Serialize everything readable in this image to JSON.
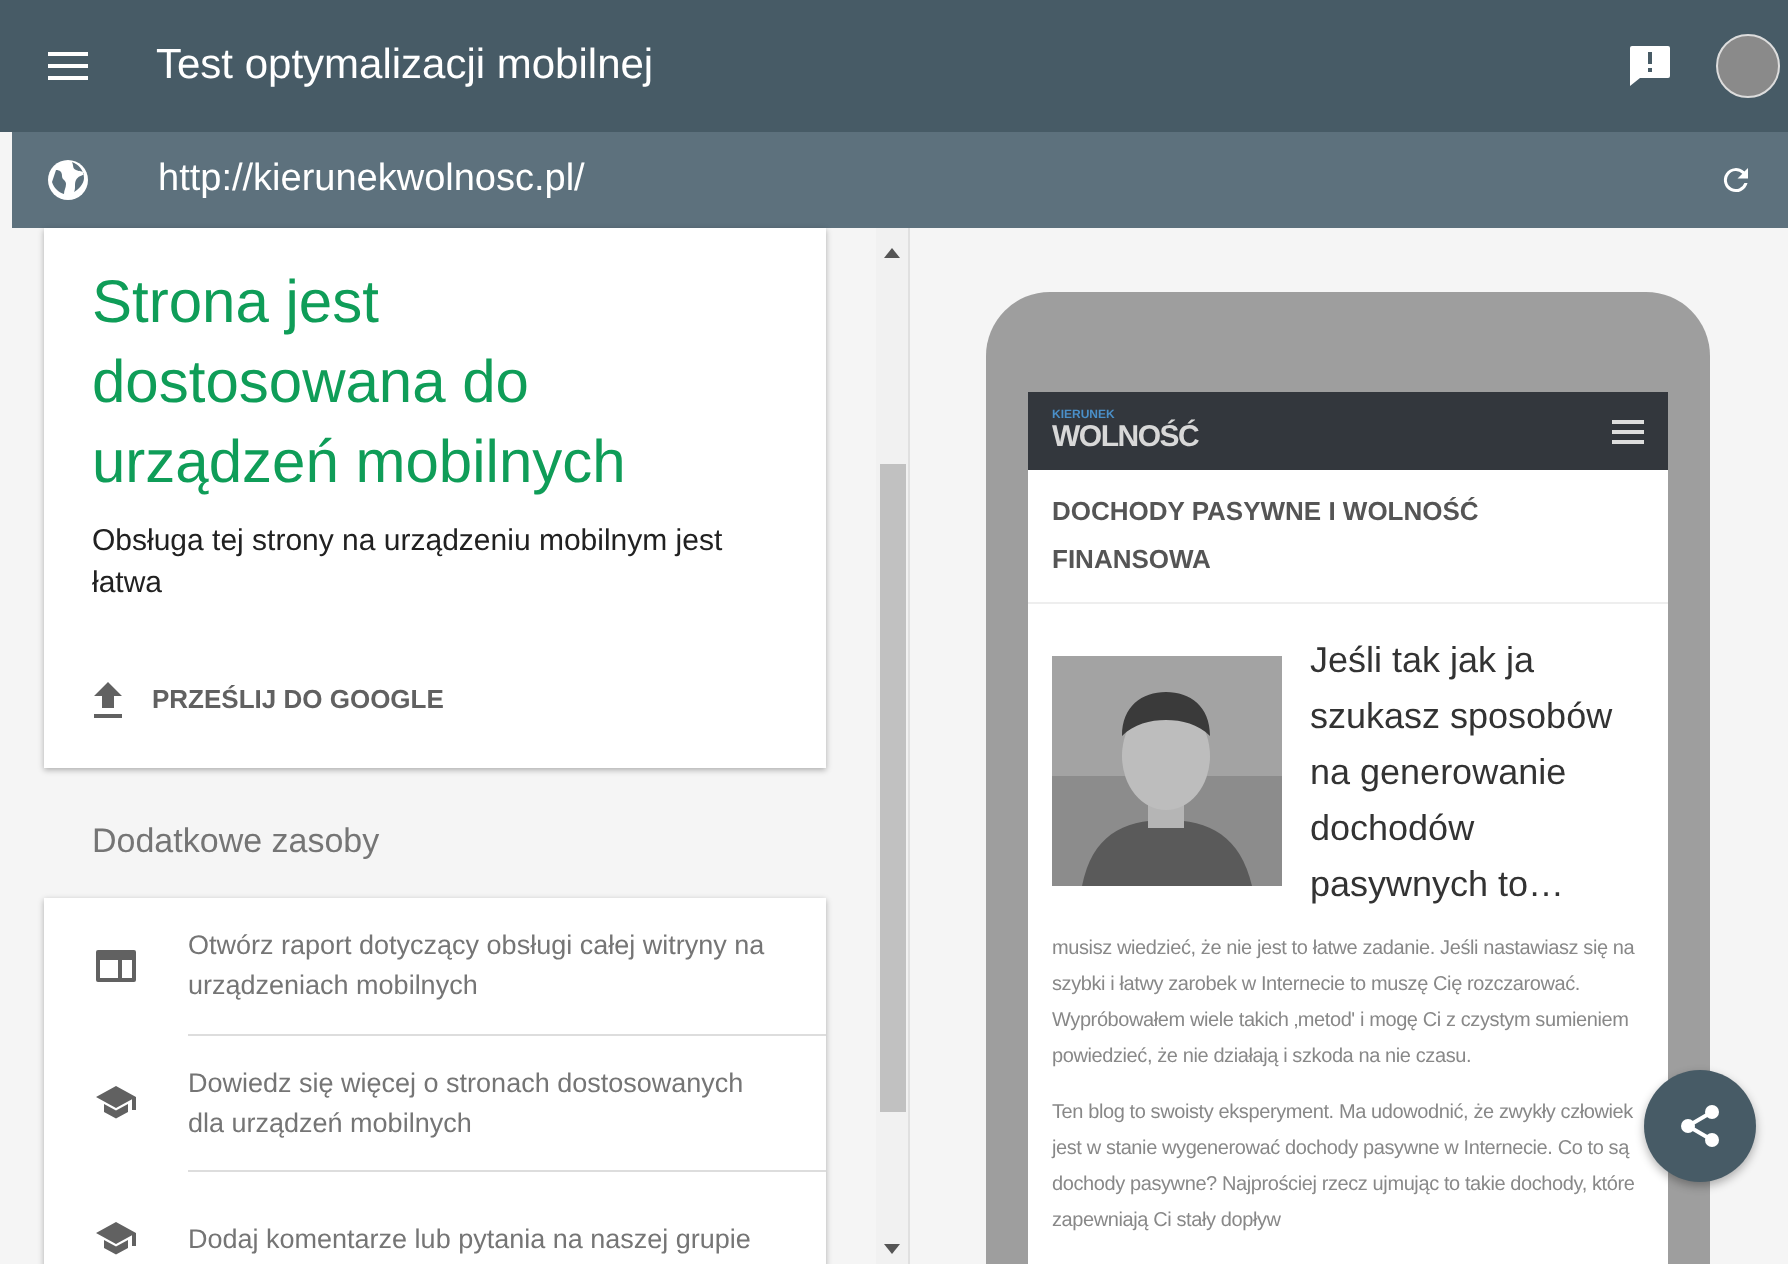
{
  "header": {
    "title": "Test optymalizacji mobilnej"
  },
  "url_bar": {
    "value": "http://kierunekwolnosc.pl/"
  },
  "result": {
    "heading": "Strona jest dostosowana do urządzeń mobilnych",
    "description": "Obsługa tej strony na urządzeniu mobilnym jest łatwa",
    "action": "PRZEŚLIJ DO GOOGLE"
  },
  "resources": {
    "title": "Dodatkowe zasoby",
    "items": [
      {
        "kind": "report",
        "text": "Otwórz raport dotyczący obsługi całej witryny na urządzeniach mobilnych"
      },
      {
        "kind": "learn",
        "text": "Dowiedz się więcej o stronach dostosowanych dla urządzeń mobilnych"
      },
      {
        "kind": "learn",
        "text": "Dodaj komentarze lub pytania na naszej grupie"
      }
    ]
  },
  "preview": {
    "logo_top": "KIERUNEK",
    "logo_bottom": "WOLNOŚĆ",
    "page_title": "DOCHODY PASYWNE I WOLNOŚĆ FINANSOWA",
    "heading": "Jeśli tak jak ja szukasz sposobów na generowanie dochodów pasywnych to…",
    "paragraphs": [
      "musisz wiedzieć, że nie jest to łatwe zadanie. Jeśli nastawiasz się na szybki i łatwy zarobek w Internecie to muszę Cię rozczarować. Wypróbowałem wiele takich ‚metod' i mogę Ci z czystym sumieniem powiedzieć, że nie działają i szkoda na nie czasu.",
      "Ten blog to swoisty eksperyment. Ma udowodnić, że zwykły człowiek jest w stanie wygenerować dochody pasywne w Internecie. Co to są dochody pasywne?  Najprościej rzecz ujmując to takie dochody, które zapewniają Ci stały dopływ"
    ]
  }
}
